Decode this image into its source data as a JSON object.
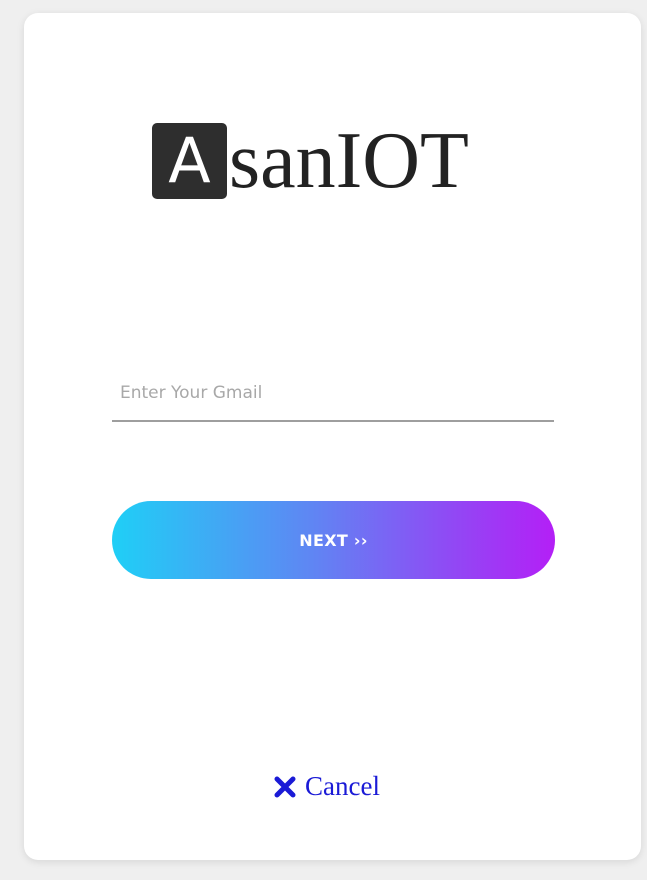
{
  "logo": {
    "initial": "A",
    "rest": "sanIOT"
  },
  "email": {
    "value": "",
    "placeholder": "Enter Your Gmail"
  },
  "next_button": {
    "label": "NEXT ››",
    "gradient": [
      "#1fcff6",
      "#b41ff6"
    ]
  },
  "cancel": {
    "icon": "close-icon",
    "label": "Cancel",
    "color": "#1a1ad6"
  }
}
